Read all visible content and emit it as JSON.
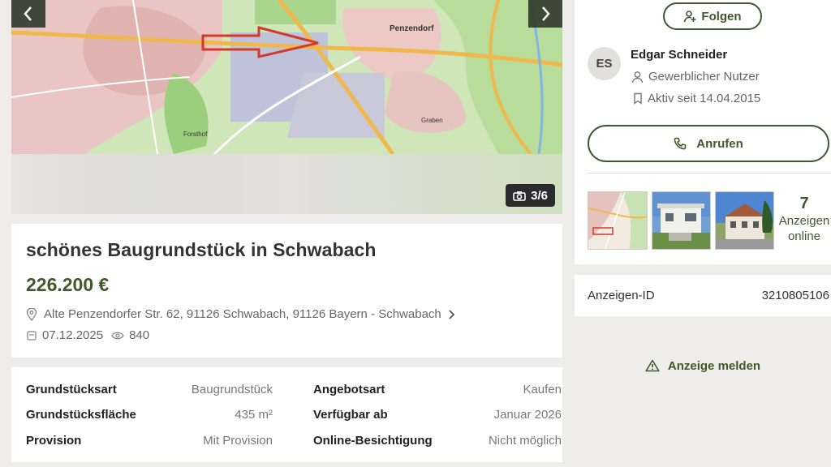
{
  "gallery": {
    "counter": "3/6",
    "map_labels": [
      "Penzendorf",
      "Forsthof",
      "Graben"
    ]
  },
  "listing": {
    "title": "schönes Baugrundstück in Schwabach",
    "price": "226.200 €",
    "address": "Alte Penzendorfer Str. 62, 91126 Schwabach, 91126 Bayern - Schwabach",
    "date": "07.12.2025",
    "views": "840"
  },
  "details": [
    {
      "label": "Grundstücksart",
      "value": "Baugrundstück"
    },
    {
      "label": "Angebotsart",
      "value": "Kaufen"
    },
    {
      "label": "Grundstücksfläche",
      "value": "435 m²"
    },
    {
      "label": "Verfügbar ab",
      "value": "Januar 2026"
    },
    {
      "label": "Provision",
      "value": "Mit Provision"
    },
    {
      "label": "Online-Besichtigung",
      "value": "Nicht möglich"
    }
  ],
  "seller": {
    "follow_label": "Folgen",
    "initials": "ES",
    "name": "Edgar Schneider",
    "type": "Gewerblicher Nutzer",
    "active_since": "Aktiv seit 14.04.2015",
    "call_label": "Anrufen",
    "ads_count": "7",
    "ads_label": "Anzeigen online"
  },
  "ad_id": {
    "label": "Anzeigen-ID",
    "value": "3210805106"
  },
  "report_label": "Anzeige melden",
  "colors": {
    "accent": "#3e5a2c",
    "background": "#efedeb",
    "card": "#ffffff"
  }
}
